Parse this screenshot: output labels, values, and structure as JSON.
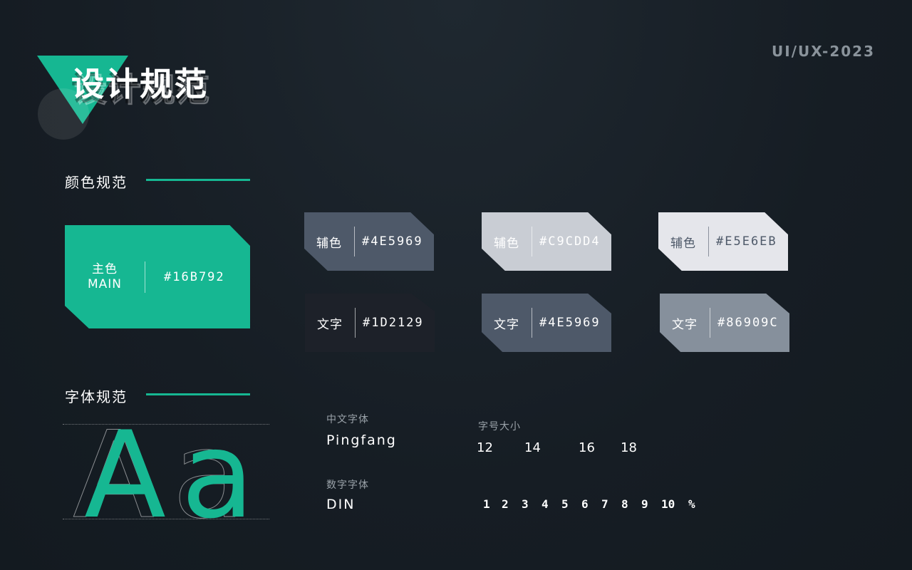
{
  "header": {
    "title": "设计规范",
    "corner_tag": "UI/UX-2023"
  },
  "colors": {
    "accent": "#16B792",
    "section_title": "颜色规范",
    "main": {
      "label": "主色",
      "label_en": "MAIN",
      "hex": "#16B792",
      "fill": "#16B792"
    },
    "swatches": [
      {
        "label": "辅色",
        "hex": "#4E5969",
        "fill": "#4E5969",
        "text_color": "#FFFFFF"
      },
      {
        "label": "辅色",
        "hex": "#C9CDD4",
        "fill": "#C9CDD4",
        "text_color": "#FFFFFF"
      },
      {
        "label": "辅色",
        "hex": "#E5E6EB",
        "fill": "#E5E6EB",
        "text_color": "#4E5969"
      },
      {
        "label": "文字",
        "hex": "#1D2129",
        "fill": "#1D2129",
        "text_color": "#FFFFFF"
      },
      {
        "label": "文字",
        "hex": "#4E5969",
        "fill": "#4E5969",
        "text_color": "#FFFFFF"
      },
      {
        "label": "文字",
        "hex": "#86909C",
        "fill": "#86909C",
        "text_color": "#FFFFFF"
      }
    ]
  },
  "typography": {
    "section_title": "字体规范",
    "glyph_upper": "A",
    "glyph_lower": "a",
    "chinese_font_caption": "中文字体",
    "chinese_font": "Pingfang",
    "number_font_caption": "数字字体",
    "number_font": "DIN",
    "size_caption": "字号大小",
    "sizes": [
      "12",
      "14",
      "16",
      "18"
    ],
    "numerals": [
      "1",
      "2",
      "3",
      "4",
      "5",
      "6",
      "7",
      "8",
      "9",
      "10",
      "%"
    ]
  }
}
